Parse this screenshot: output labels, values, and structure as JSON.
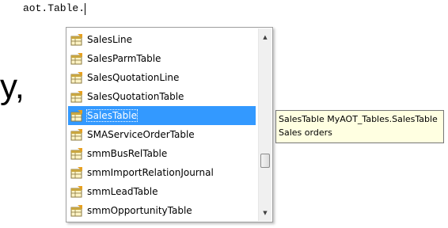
{
  "editor": {
    "code_text": "aot.Table."
  },
  "background": {
    "partial_text": "y,"
  },
  "intellisense": {
    "icon": "table-icon",
    "selected_index": 4,
    "items": [
      {
        "label": "SalesLine"
      },
      {
        "label": "SalesParmTable"
      },
      {
        "label": "SalesQuotationLine"
      },
      {
        "label": "SalesQuotationTable"
      },
      {
        "label": "SalesTable"
      },
      {
        "label": "SMAServiceOrderTable"
      },
      {
        "label": "smmBusRelTable"
      },
      {
        "label": "smmImportRelationJournal"
      },
      {
        "label": "smmLeadTable"
      },
      {
        "label": "smmOpportunityTable"
      }
    ],
    "scrollbar": {
      "up_glyph": "▲",
      "down_glyph": "▼"
    }
  },
  "tooltip": {
    "line1": "SalesTable MyAOT_Tables.SalesTable",
    "line2": "Sales orders"
  },
  "colors": {
    "selection": "#3399ff",
    "tooltip_bg": "#ffffe1"
  }
}
